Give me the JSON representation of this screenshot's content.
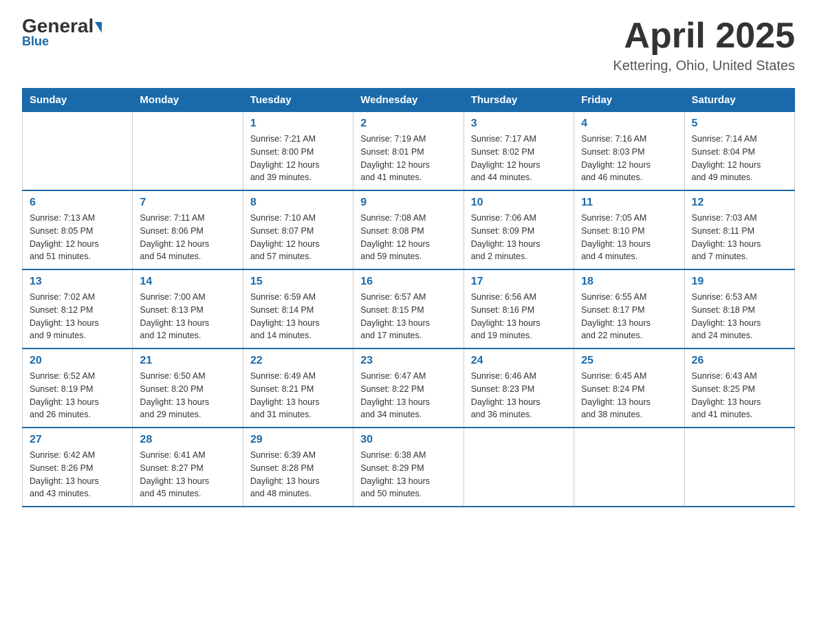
{
  "header": {
    "logo_general": "General",
    "logo_blue": "Blue",
    "month_year": "April 2025",
    "location": "Kettering, Ohio, United States"
  },
  "days_of_week": [
    "Sunday",
    "Monday",
    "Tuesday",
    "Wednesday",
    "Thursday",
    "Friday",
    "Saturday"
  ],
  "weeks": [
    [
      {
        "day": "",
        "info": ""
      },
      {
        "day": "",
        "info": ""
      },
      {
        "day": "1",
        "info": "Sunrise: 7:21 AM\nSunset: 8:00 PM\nDaylight: 12 hours\nand 39 minutes."
      },
      {
        "day": "2",
        "info": "Sunrise: 7:19 AM\nSunset: 8:01 PM\nDaylight: 12 hours\nand 41 minutes."
      },
      {
        "day": "3",
        "info": "Sunrise: 7:17 AM\nSunset: 8:02 PM\nDaylight: 12 hours\nand 44 minutes."
      },
      {
        "day": "4",
        "info": "Sunrise: 7:16 AM\nSunset: 8:03 PM\nDaylight: 12 hours\nand 46 minutes."
      },
      {
        "day": "5",
        "info": "Sunrise: 7:14 AM\nSunset: 8:04 PM\nDaylight: 12 hours\nand 49 minutes."
      }
    ],
    [
      {
        "day": "6",
        "info": "Sunrise: 7:13 AM\nSunset: 8:05 PM\nDaylight: 12 hours\nand 51 minutes."
      },
      {
        "day": "7",
        "info": "Sunrise: 7:11 AM\nSunset: 8:06 PM\nDaylight: 12 hours\nand 54 minutes."
      },
      {
        "day": "8",
        "info": "Sunrise: 7:10 AM\nSunset: 8:07 PM\nDaylight: 12 hours\nand 57 minutes."
      },
      {
        "day": "9",
        "info": "Sunrise: 7:08 AM\nSunset: 8:08 PM\nDaylight: 12 hours\nand 59 minutes."
      },
      {
        "day": "10",
        "info": "Sunrise: 7:06 AM\nSunset: 8:09 PM\nDaylight: 13 hours\nand 2 minutes."
      },
      {
        "day": "11",
        "info": "Sunrise: 7:05 AM\nSunset: 8:10 PM\nDaylight: 13 hours\nand 4 minutes."
      },
      {
        "day": "12",
        "info": "Sunrise: 7:03 AM\nSunset: 8:11 PM\nDaylight: 13 hours\nand 7 minutes."
      }
    ],
    [
      {
        "day": "13",
        "info": "Sunrise: 7:02 AM\nSunset: 8:12 PM\nDaylight: 13 hours\nand 9 minutes."
      },
      {
        "day": "14",
        "info": "Sunrise: 7:00 AM\nSunset: 8:13 PM\nDaylight: 13 hours\nand 12 minutes."
      },
      {
        "day": "15",
        "info": "Sunrise: 6:59 AM\nSunset: 8:14 PM\nDaylight: 13 hours\nand 14 minutes."
      },
      {
        "day": "16",
        "info": "Sunrise: 6:57 AM\nSunset: 8:15 PM\nDaylight: 13 hours\nand 17 minutes."
      },
      {
        "day": "17",
        "info": "Sunrise: 6:56 AM\nSunset: 8:16 PM\nDaylight: 13 hours\nand 19 minutes."
      },
      {
        "day": "18",
        "info": "Sunrise: 6:55 AM\nSunset: 8:17 PM\nDaylight: 13 hours\nand 22 minutes."
      },
      {
        "day": "19",
        "info": "Sunrise: 6:53 AM\nSunset: 8:18 PM\nDaylight: 13 hours\nand 24 minutes."
      }
    ],
    [
      {
        "day": "20",
        "info": "Sunrise: 6:52 AM\nSunset: 8:19 PM\nDaylight: 13 hours\nand 26 minutes."
      },
      {
        "day": "21",
        "info": "Sunrise: 6:50 AM\nSunset: 8:20 PM\nDaylight: 13 hours\nand 29 minutes."
      },
      {
        "day": "22",
        "info": "Sunrise: 6:49 AM\nSunset: 8:21 PM\nDaylight: 13 hours\nand 31 minutes."
      },
      {
        "day": "23",
        "info": "Sunrise: 6:47 AM\nSunset: 8:22 PM\nDaylight: 13 hours\nand 34 minutes."
      },
      {
        "day": "24",
        "info": "Sunrise: 6:46 AM\nSunset: 8:23 PM\nDaylight: 13 hours\nand 36 minutes."
      },
      {
        "day": "25",
        "info": "Sunrise: 6:45 AM\nSunset: 8:24 PM\nDaylight: 13 hours\nand 38 minutes."
      },
      {
        "day": "26",
        "info": "Sunrise: 6:43 AM\nSunset: 8:25 PM\nDaylight: 13 hours\nand 41 minutes."
      }
    ],
    [
      {
        "day": "27",
        "info": "Sunrise: 6:42 AM\nSunset: 8:26 PM\nDaylight: 13 hours\nand 43 minutes."
      },
      {
        "day": "28",
        "info": "Sunrise: 6:41 AM\nSunset: 8:27 PM\nDaylight: 13 hours\nand 45 minutes."
      },
      {
        "day": "29",
        "info": "Sunrise: 6:39 AM\nSunset: 8:28 PM\nDaylight: 13 hours\nand 48 minutes."
      },
      {
        "day": "30",
        "info": "Sunrise: 6:38 AM\nSunset: 8:29 PM\nDaylight: 13 hours\nand 50 minutes."
      },
      {
        "day": "",
        "info": ""
      },
      {
        "day": "",
        "info": ""
      },
      {
        "day": "",
        "info": ""
      }
    ]
  ]
}
